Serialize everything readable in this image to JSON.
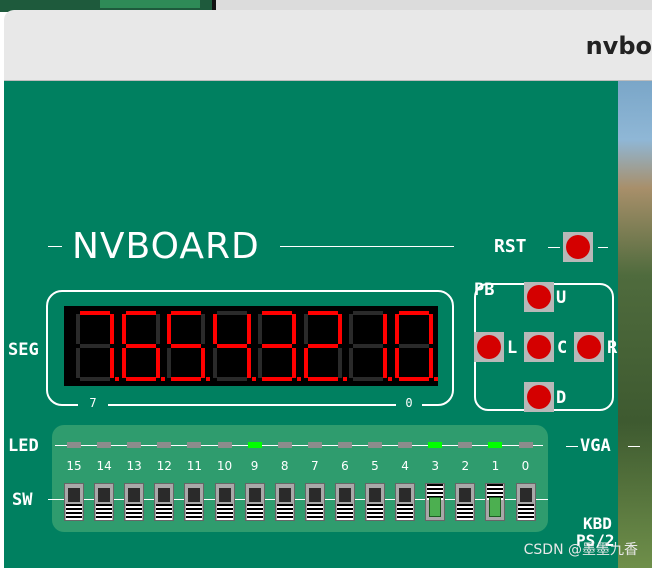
{
  "window": {
    "title": "nvbo"
  },
  "board": {
    "title": "NVBOARD",
    "labels": {
      "seg": "SEG",
      "led": "LED",
      "sw": "SW",
      "vga": "VGA",
      "rst": "RST",
      "pb": "PB",
      "kbd": "KBD",
      "ps2": "PS/2"
    },
    "seg_left_index": "7",
    "seg_right_index": "0",
    "seg_digits": [
      "7",
      "6",
      "5",
      "4",
      "3",
      "2",
      "1",
      "0"
    ],
    "pb_labels": {
      "up": "U",
      "left": "L",
      "center": "C",
      "right": "R",
      "down": "D"
    },
    "switch_numbers": [
      "15",
      "14",
      "13",
      "12",
      "11",
      "10",
      "9",
      "8",
      "7",
      "6",
      "5",
      "4",
      "3",
      "2",
      "1",
      "0"
    ],
    "led_states": [
      false,
      false,
      false,
      false,
      false,
      false,
      true,
      false,
      false,
      false,
      false,
      false,
      true,
      false,
      true,
      false
    ],
    "switch_states": [
      false,
      false,
      false,
      false,
      false,
      false,
      false,
      false,
      false,
      false,
      false,
      false,
      true,
      false,
      true,
      false
    ],
    "colors": {
      "board": "#008060",
      "seg_on": "#ff0000",
      "led_on": "#00ff00",
      "button": "#d40000"
    }
  },
  "watermark": "CSDN @墨墨九香"
}
